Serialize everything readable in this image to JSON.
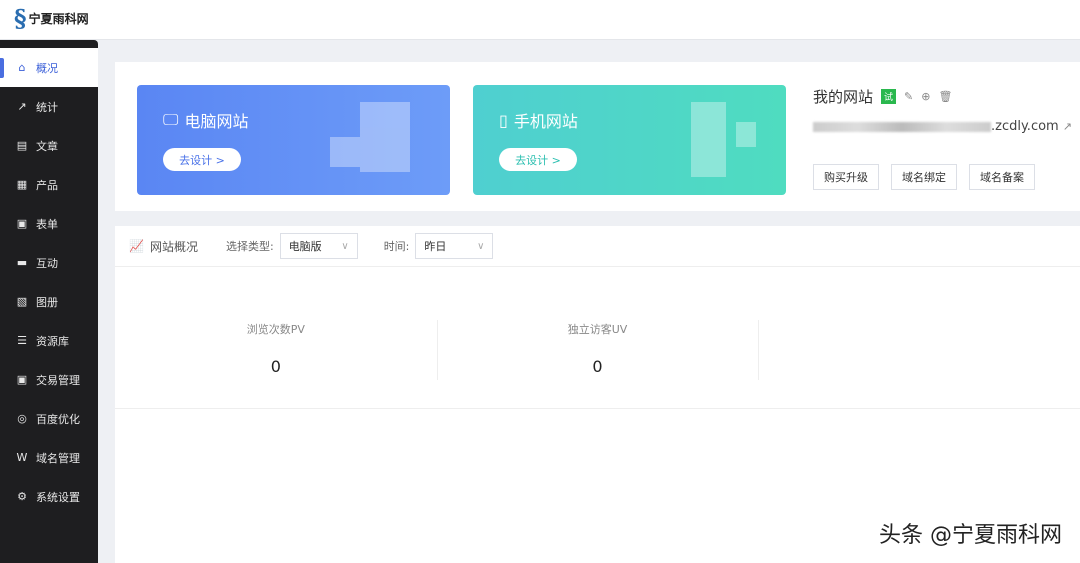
{
  "brand": {
    "logo": "宁夏雨科网"
  },
  "sidebar": {
    "items": [
      {
        "label": "概况",
        "icon": "home-icon",
        "glyph": "⌂"
      },
      {
        "label": "统计",
        "icon": "chart-icon",
        "glyph": "↗"
      },
      {
        "label": "文章",
        "icon": "article-icon",
        "glyph": "▤"
      },
      {
        "label": "产品",
        "icon": "grid-icon",
        "glyph": "▦"
      },
      {
        "label": "表单",
        "icon": "form-icon",
        "glyph": "▣"
      },
      {
        "label": "互动",
        "icon": "chat-icon",
        "glyph": "▬"
      },
      {
        "label": "图册",
        "icon": "album-icon",
        "glyph": "▧"
      },
      {
        "label": "资源库",
        "icon": "database-icon",
        "glyph": "☰"
      },
      {
        "label": "交易管理",
        "icon": "trade-icon",
        "glyph": "▣"
      },
      {
        "label": "百度优化",
        "icon": "seo-icon",
        "glyph": "◎"
      },
      {
        "label": "域名管理",
        "icon": "domain-icon",
        "glyph": "W"
      },
      {
        "label": "系统设置",
        "icon": "gear-icon",
        "glyph": "⚙"
      }
    ]
  },
  "cards": {
    "pc": {
      "title": "电脑网站",
      "button": "去设计 >"
    },
    "mobile": {
      "title": "手机网站",
      "button": "去设计 >"
    }
  },
  "site": {
    "title": "我的网站",
    "badge": "试",
    "url_suffix": ".zcdly.com",
    "buttons": [
      "购买升级",
      "域名绑定",
      "域名备案"
    ]
  },
  "overview": {
    "title": "网站概况",
    "type_label": "选择类型:",
    "type_value": "电脑版",
    "time_label": "时间:",
    "time_value": "昨日",
    "stats": [
      {
        "label": "浏览次数PV",
        "value": "0"
      },
      {
        "label": "独立访客UV",
        "value": "0"
      }
    ]
  },
  "watermark": "头条 @宁夏雨科网"
}
